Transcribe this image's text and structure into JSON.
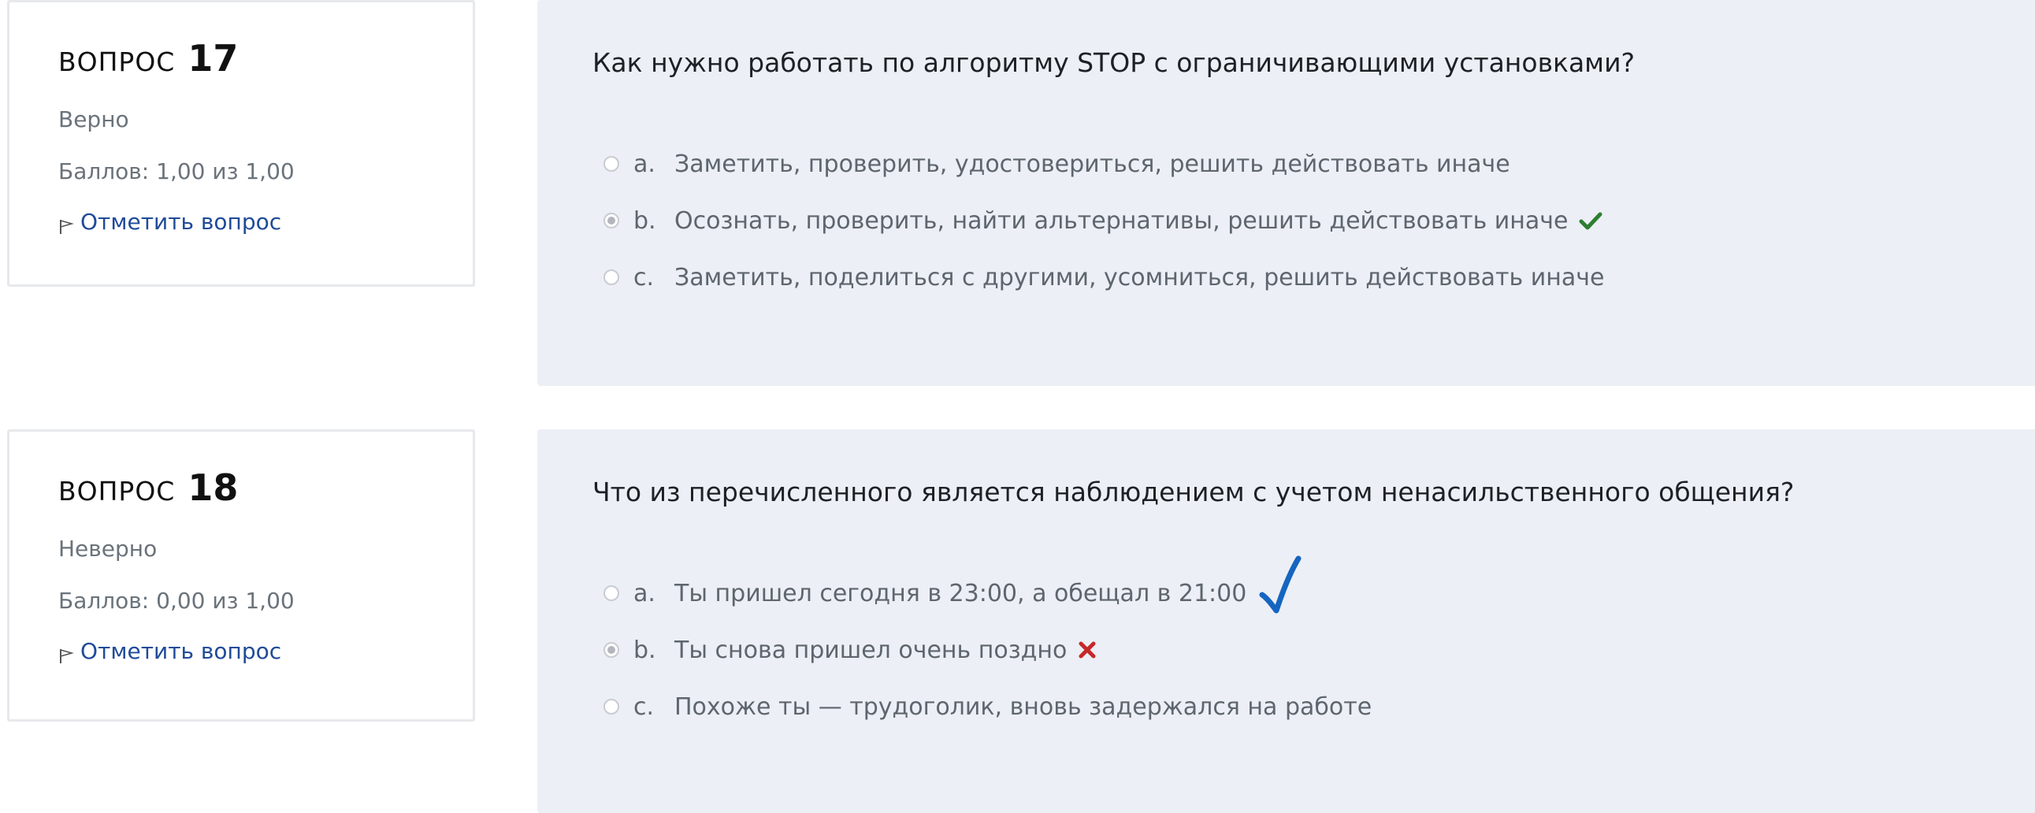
{
  "questions": [
    {
      "word": "ВОПРОС",
      "number": "17",
      "state": "Верно",
      "grade": "Баллов: 1,00 из 1,00",
      "flag_label": "Отметить вопрос",
      "text": "Как нужно работать по алгоритму STOP с ограничивающими установками?",
      "answers": [
        {
          "letter": "a.",
          "text": "Заметить, проверить, удостовериться, решить действовать иначе",
          "selected": false
        },
        {
          "letter": "b.",
          "text": "Осознать, проверить, найти альтернативы, решить действовать иначе",
          "selected": true,
          "mark": "correct-check-icon"
        },
        {
          "letter": "c.",
          "text": "Заметить, поделиться с другими, усомниться, решить действовать иначе",
          "selected": false
        }
      ]
    },
    {
      "word": "ВОПРОС",
      "number": "18",
      "state": "Неверно",
      "grade": "Баллов: 0,00 из 1,00",
      "flag_label": "Отметить вопрос",
      "text": "Что из перечисленного является наблюдением с учетом ненасильственного общения?",
      "answers": [
        {
          "letter": "a.",
          "text": "Ты пришел сегодня в 23:00, а обещал в 21:00",
          "selected": false,
          "mark": "handdrawn-check-icon"
        },
        {
          "letter": "b.",
          "text": "Ты снова пришел очень поздно",
          "selected": true,
          "mark": "incorrect-cross-icon"
        },
        {
          "letter": "c.",
          "text": "Похоже ты — трудоголик, вновь задержался на работе",
          "selected": false
        }
      ]
    }
  ],
  "colors": {
    "correct": "#2e7d32",
    "incorrect": "#c62828",
    "handdrawn": "#1565c0",
    "link": "#1f4b99",
    "content_bg": "#eceff5"
  }
}
